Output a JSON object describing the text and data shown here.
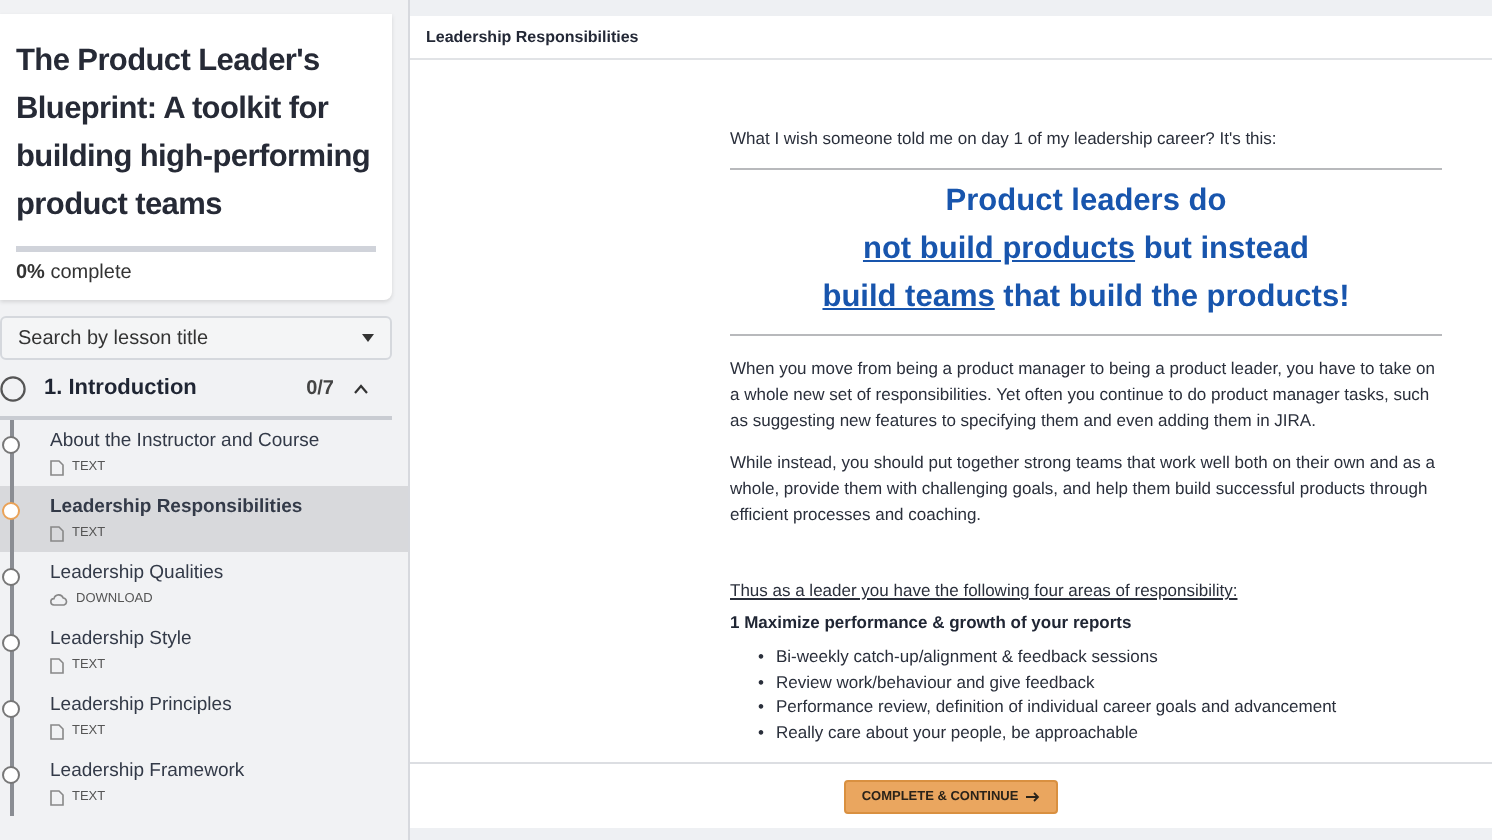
{
  "course": {
    "title": "The Product Leader's Blueprint: A toolkit for building high-performing product teams",
    "progress": {
      "level": 0,
      "text": "**0%** complete"
    }
  },
  "search": {
    "placeholder": "Search by lesson title"
  },
  "section": {
    "title": "1. Introduction",
    "count": "0/7",
    "expanded": true,
    "completed": false
  },
  "lessons": [
    {
      "title": "About the Instructor and Course",
      "kind": "text",
      "type": "TEXT",
      "selected": false
    },
    {
      "title": "Leadership Responsibilities",
      "kind": "text",
      "type": "TEXT",
      "selected": true
    },
    {
      "title": "Leadership Qualities",
      "kind": "download",
      "type": "DOWNLOAD",
      "selected": false
    },
    {
      "title": "Leadership Style",
      "kind": "text",
      "type": "TEXT",
      "selected": false
    },
    {
      "title": "Leadership Principles",
      "kind": "text",
      "type": "TEXT",
      "selected": false
    },
    {
      "title": "Leadership Framework",
      "kind": "text",
      "type": "TEXT",
      "selected": false
    }
  ],
  "lesson": {
    "title": "Leadership Responsibilities",
    "intro": "What I wish someone told me on day 1 of my leadership career? It's this:",
    "headline": [
      [
        {
          "text": "Product leaders do",
          "link": false
        }
      ],
      [
        {
          "text": "not build products",
          "link": true
        },
        {
          "text": " but instead",
          "link": false
        }
      ],
      [
        {
          "text": "build teams",
          "link": true
        },
        {
          "text": " that build the products!",
          "link": false
        }
      ]
    ],
    "paragraphs": [
      "When you move from being a product manager to being a product leader, you have to take on a whole new set of responsibilities. Yet often you continue to do product manager tasks, such as suggesting new features to specifying them and even adding them in JIRA.",
      "While instead, you should put together strong teams that work well both on their own and as a whole, provide them with challenging goals, and help them build successful products through efficient processes and coaching."
    ],
    "lead_in": "Thus as a leader you have the following four areas of responsibility:",
    "heading": "1 Maximize performance & growth of your reports",
    "bullet_marker": "•",
    "bullets": [
      "Bi-weekly catch-up/alignment & feedback sessions",
      "Review work/behaviour and give feedback",
      "Performance review, definition of individual career goals and advancement",
      "Really care about your people, be approachable"
    ]
  },
  "footer": {
    "button": "COMPLETE & CONTINUE"
  }
}
